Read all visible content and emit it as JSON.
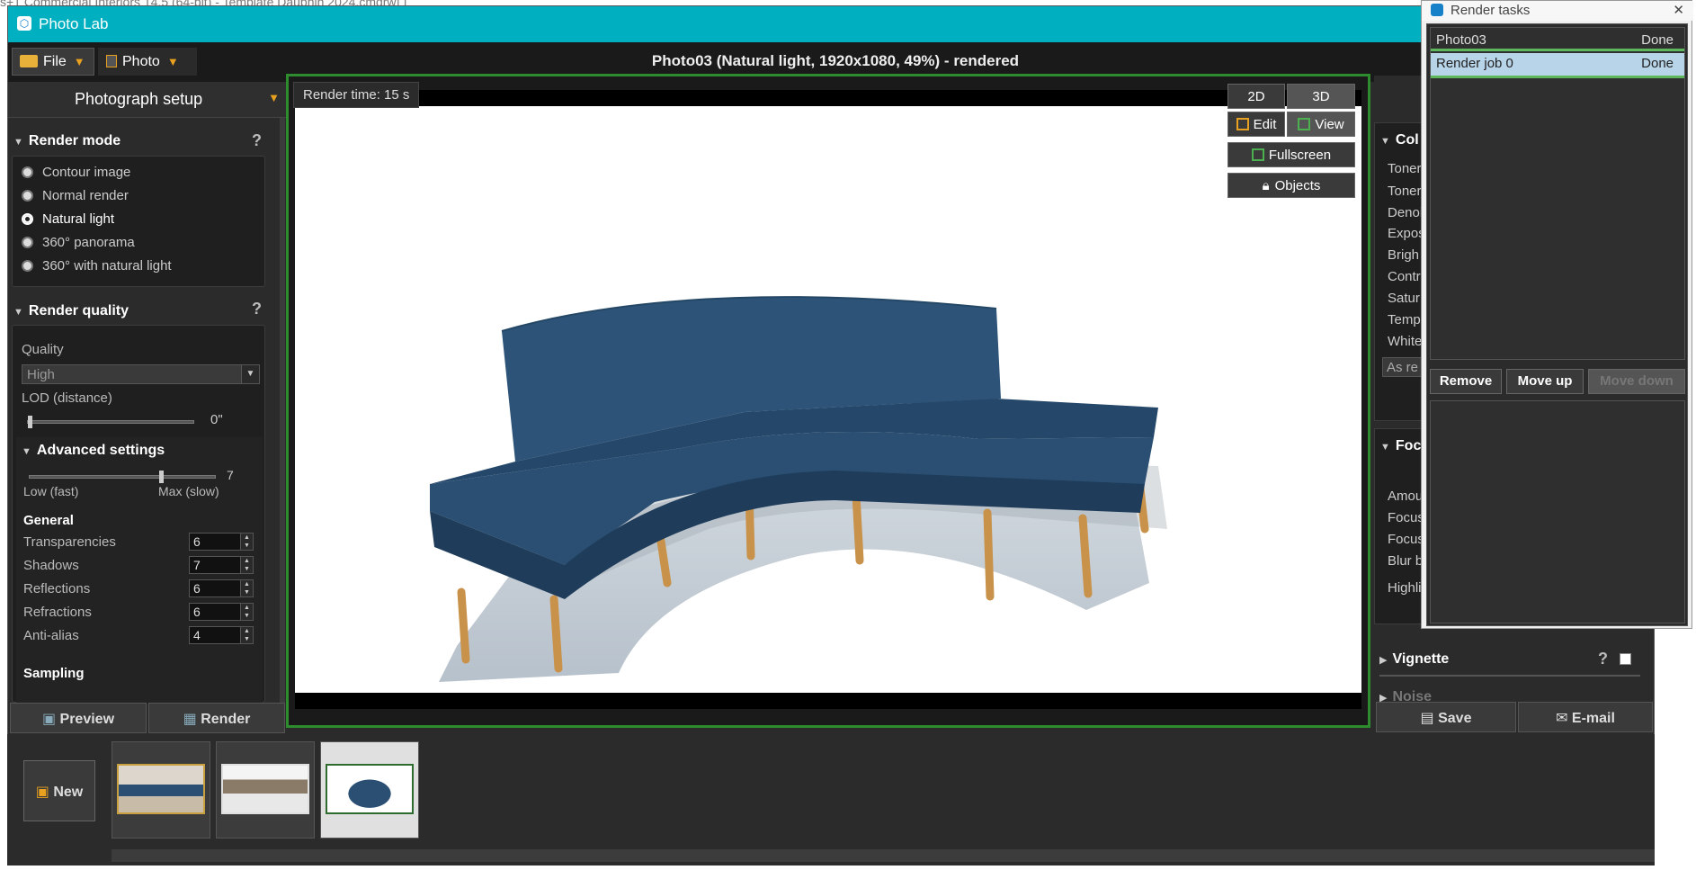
{
  "background_title": "s+1 Commercial Interiors 14.5 (64-bit) - Template Dauphin 2024.cmdrw] ]",
  "app": {
    "title": "Photo Lab"
  },
  "menu": {
    "file": "File",
    "photo": "Photo",
    "document_title": "Photo03 (Natural light, 1920x1080, 49%) - rendered"
  },
  "left": {
    "header": "Photograph setup",
    "render_mode": {
      "title": "Render mode",
      "help": "?",
      "options": [
        "Contour image",
        "Normal render",
        "Natural light",
        "360° panorama",
        "360° with natural light"
      ],
      "selected": "Natural light"
    },
    "render_quality": {
      "title": "Render quality",
      "help": "?",
      "quality_label": "Quality",
      "quality_value": "High",
      "lod_label": "LOD (distance)",
      "lod_value": "0\"",
      "lod_level": 0
    },
    "advanced": {
      "title": "Advanced settings",
      "slider_value": "7",
      "slider_level": 0.7,
      "low_label": "Low (fast)",
      "max_label": "Max (slow)",
      "general_title": "General",
      "fields": [
        {
          "label": "Transparencies",
          "value": "6"
        },
        {
          "label": "Shadows",
          "value": "7"
        },
        {
          "label": "Reflections",
          "value": "6"
        },
        {
          "label": "Refractions",
          "value": "6"
        },
        {
          "label": "Anti-alias",
          "value": "4"
        }
      ],
      "sampling_title": "Sampling"
    },
    "preview_button": "Preview",
    "render_button": "Render"
  },
  "viewport": {
    "render_time": "Render time: 15 s",
    "btn_2d": "2D",
    "btn_3d": "3D",
    "btn_edit": "Edit",
    "btn_view": "View",
    "btn_fullscreen": "Fullscreen",
    "btn_objects": "Objects"
  },
  "right": {
    "color_title": "Col",
    "color_rows": [
      "Toner",
      "Toner",
      "Denoi",
      "Expos",
      "Brigh",
      "Contr",
      "Satur",
      "Temp",
      "White"
    ],
    "as_btn": "As re",
    "focus_title": "Foc",
    "focus_rows": [
      "Amou",
      "Focus",
      "Focus",
      "Blur b",
      "Highli"
    ],
    "vignette": "Vignette",
    "noise": "Noise",
    "help": "?",
    "save_button": "Save",
    "email_button": "E-mail"
  },
  "render_tasks": {
    "title": "Render tasks",
    "close": "✕",
    "rows": [
      {
        "name": "Photo03",
        "status": "Done"
      },
      {
        "name": "Render job 0",
        "status": "Done"
      }
    ],
    "remove": "Remove",
    "move_up": "Move up",
    "move_down": "Move down"
  },
  "thumbs": {
    "new_button": "New"
  },
  "colors": {
    "titlebar": "#00b0c0",
    "accent": "#e8a020",
    "viewport_border": "#2e8b2e",
    "sofa": "#2b4f72"
  }
}
